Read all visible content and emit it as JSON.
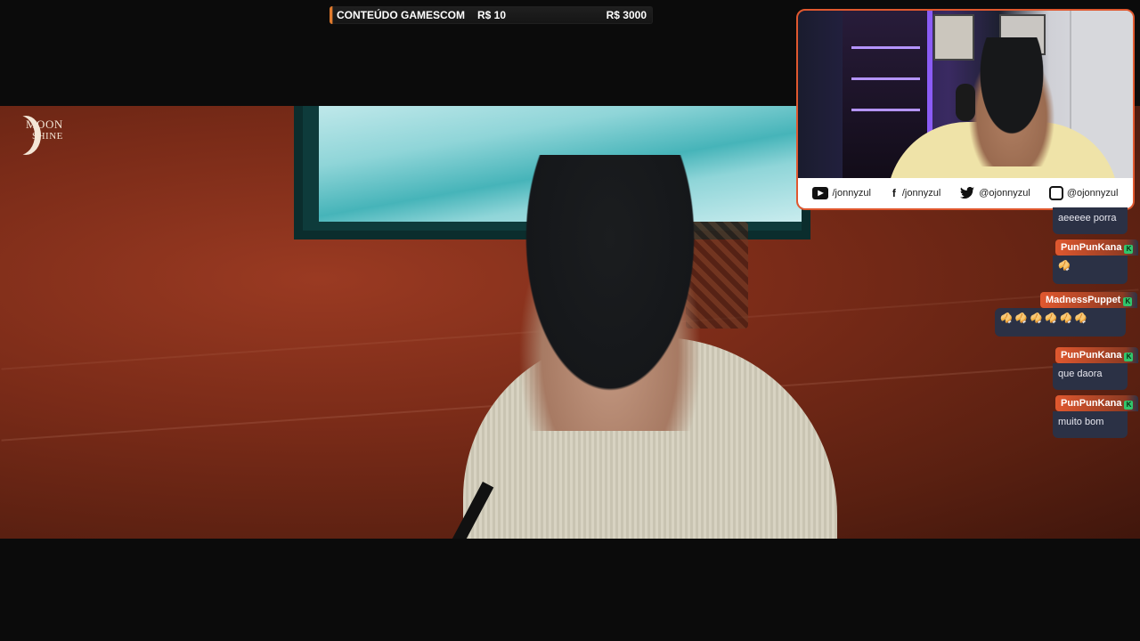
{
  "goal": {
    "title": "CONTEÚDO GAMESCOM",
    "current": "R$ 10",
    "target": "R$ 3000",
    "progress_fraction": 0.0033,
    "accent_color": "#e07a2d"
  },
  "overlay_logo": {
    "line1": "MOON",
    "line2": "SHINE"
  },
  "webcam": {
    "border_color": "#e0582f",
    "socials": [
      {
        "icon": "youtube-icon",
        "handle": "/jonnyzul"
      },
      {
        "icon": "facebook-icon",
        "handle": "/jonnyzul"
      },
      {
        "icon": "twitter-icon",
        "handle": "@ojonnyzul"
      },
      {
        "icon": "instagram-icon",
        "handle": "@ojonnyzul"
      }
    ]
  },
  "chat": {
    "messages": [
      {
        "user": "",
        "text": "aeeeee porra"
      },
      {
        "user": "PunPunKana",
        "text": "🥠"
      },
      {
        "user": "MadnessPuppet",
        "text": "🥠 🥠 🥠 🥠 🥠 🥠"
      },
      {
        "user": "PunPunKana",
        "text": "que daora"
      },
      {
        "user": "PunPunKana",
        "text": "muito bom"
      }
    ],
    "badge_color": "#31c46b"
  }
}
